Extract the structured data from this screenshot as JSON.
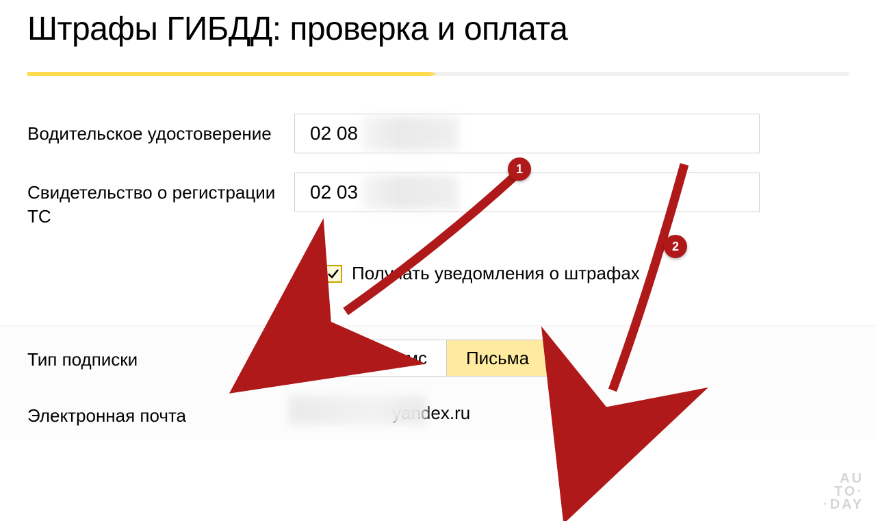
{
  "page": {
    "title": "Штрафы ГИБДД: проверка и оплата"
  },
  "form": {
    "license_label": "Водительское удостоверение",
    "license_value": "02 08",
    "registration_label": "Свидетельство о регистрации ТС",
    "registration_value": "02 03",
    "notify_checkbox_label": "Получать уведомления о штрафах",
    "subscription_label": "Тип подписки",
    "toggle_option_both": "Письма и смс",
    "toggle_option_email": "Письма",
    "email_label": "Электронная почта",
    "email_value_suffix": "yandex.ru"
  },
  "annotations": {
    "badge1": "1",
    "badge2": "2"
  },
  "watermark": {
    "line1": "AU",
    "line2": "TO",
    "line3": "DAY"
  }
}
